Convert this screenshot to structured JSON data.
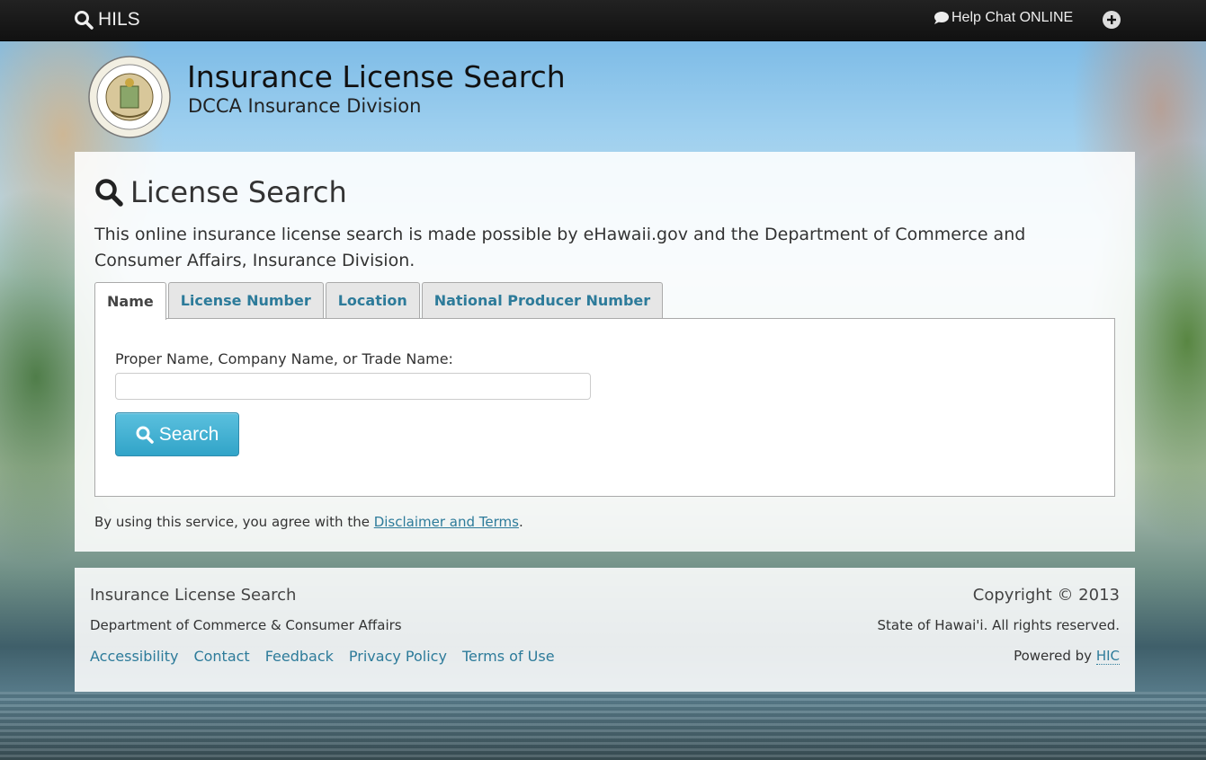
{
  "navbar": {
    "brand": "HILS",
    "help_chat": "Help Chat ONLINE",
    "icons": [
      "search-icon",
      "chat-icon",
      "plus-circle-icon"
    ]
  },
  "header": {
    "title": "Insurance License Search",
    "subtitle": "DCCA Insurance Division",
    "seal_icon": "state-seal-icon"
  },
  "search_panel": {
    "title": "License Search",
    "intro": "This online insurance license search is made possible by eHawaii.gov and the Department of Commerce and Consumer Affairs, Insurance Division.",
    "tabs": [
      {
        "label": "Name",
        "active": true
      },
      {
        "label": "License Number",
        "active": false
      },
      {
        "label": "Location",
        "active": false
      },
      {
        "label": "National Producer Number",
        "active": false
      }
    ],
    "name_field": {
      "label": "Proper Name, Company Name, or Trade Name:",
      "value": "",
      "placeholder": ""
    },
    "search_button": "Search",
    "agreement_prefix": "By using this service, you agree with the ",
    "agreement_link": "Disclaimer and Terms",
    "agreement_suffix": "."
  },
  "footer": {
    "title": "Insurance License Search",
    "department": "Department of Commerce & Consumer Affairs",
    "links": [
      "Accessibility",
      "Contact",
      "Feedback",
      "Privacy Policy",
      "Terms of Use"
    ],
    "copyright": "Copyright © 2013",
    "rights": "State of Hawai'i. All rights reserved.",
    "powered_prefix": "Powered by ",
    "powered_link": "HIC"
  },
  "colors": {
    "link": "#2d7b9a",
    "button": "#5bc0de",
    "navbar": "#1a1a1a"
  }
}
